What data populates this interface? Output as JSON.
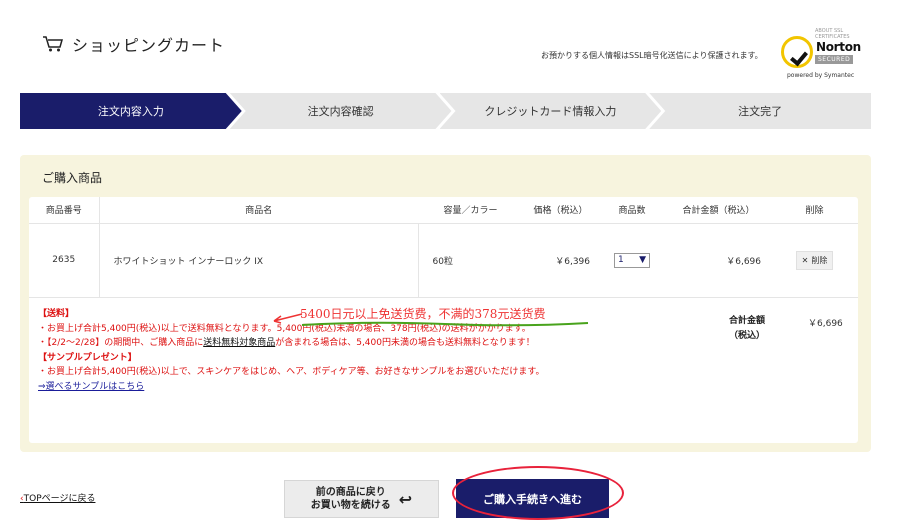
{
  "header": {
    "title": "ショッピングカート",
    "secure_note": "お預かりする個人情報はSSL暗号化送信により保護されます。",
    "norton": {
      "tiny": "ABOUT SSL CERTIFICATES",
      "brand": "Norton",
      "secured": "SECURED",
      "powered": "powered by Symantec"
    }
  },
  "steps": [
    {
      "label": "注文内容入力",
      "active": true
    },
    {
      "label": "注文内容確認",
      "active": false
    },
    {
      "label": "クレジットカード情報入力",
      "active": false
    },
    {
      "label": "注文完了",
      "active": false
    }
  ],
  "panel": {
    "title": "ご購入商品",
    "columns": [
      "商品番号",
      "商品名",
      "容量／カラー",
      "価格（税込）",
      "商品数",
      "合計金額（税込）",
      "削除"
    ],
    "row": {
      "code": "2635",
      "name": "ホワイトショット インナーロック IX",
      "volume": "60粒",
      "price": "￥6,396",
      "qty": "1",
      "total": "￥6,696",
      "delete_label": "削除"
    },
    "notes": {
      "shipping_head": "【送料】",
      "shipping_1": "・お買上げ合計5,400円(税込)以上で送料無料となります。5,400円(税込)未満の場合、378円(税込)の送料がかかります。",
      "shipping_2_pre": "・【2/2～2/28】の期間中、ご購入商品に",
      "shipping_2_link": "送料無料対象商品",
      "shipping_2_post": "が含まれる場合は、5,400円未満の場合も送料無料となります！",
      "sample_head": "【サンプルプレゼント】",
      "sample_1": "・お買上げ合計5,400円(税込)以上で、スキンケアをはじめ、ヘア、ボディケア等、お好きなサンプルをお選びいただけます。",
      "sample_link": "⇒選べるサンプルはこちら"
    },
    "total_label_1": "合計金額",
    "total_label_2": "（税込）",
    "total_value": "￥6,696"
  },
  "annotation": {
    "text": "5400日元以上免送货费，不满的378元送货费"
  },
  "footer": {
    "top_link": "TOPページに戻る",
    "back_line1": "前の商品に戻り",
    "back_line2": "お買い物を続ける",
    "proceed": "ご購入手続きへ進む"
  },
  "colors": {
    "navy": "#1a1d6a",
    "panel_bg": "#f7f4de",
    "note_red": "#dd1111",
    "annotation_red": "#e8223b"
  }
}
